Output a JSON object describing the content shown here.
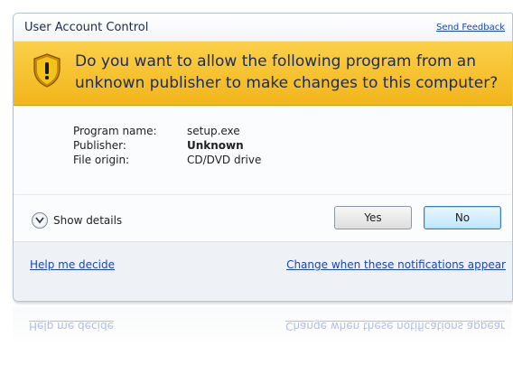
{
  "window": {
    "title": "User Account Control",
    "feedback_link": "Send Feedback"
  },
  "banner": {
    "question": "Do you want to allow the following program from an unknown publisher to make changes to this computer?",
    "icon": "shield-warning-icon"
  },
  "program_info": {
    "program_name_label": "Program name:",
    "program_name_value": "setup.exe",
    "publisher_label": "Publisher:",
    "publisher_value": "Unknown",
    "file_origin_label": "File origin:",
    "file_origin_value": "CD/DVD drive"
  },
  "actions": {
    "show_details": "Show details",
    "yes": "Yes",
    "no": "No"
  },
  "footer": {
    "help_link": "Help me decide",
    "change_link": "Change when these notifications appear"
  },
  "colors": {
    "banner": "#f5bf28",
    "link": "#1a46b5",
    "question_text": "#1b2b57"
  }
}
